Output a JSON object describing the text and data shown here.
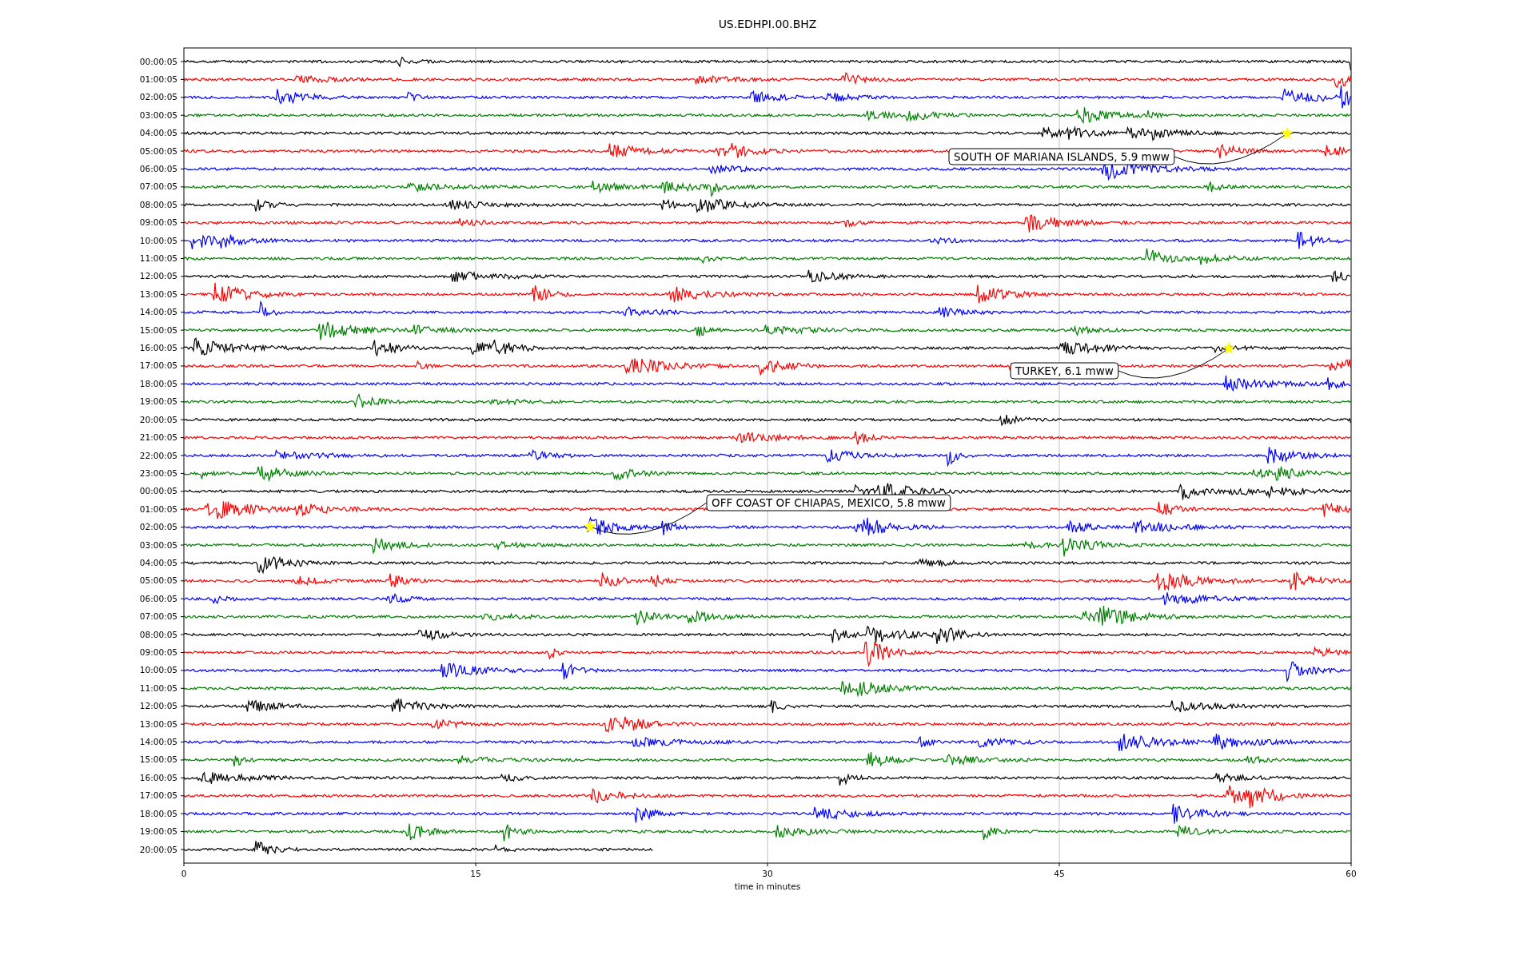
{
  "title": "US.EDHPI.00.BHZ",
  "rows": [
    {
      "label": "00:00:05",
      "color": "#000000"
    },
    {
      "label": "01:00:05",
      "color": "#ff0000"
    },
    {
      "label": "02:00:05",
      "color": "#0000ff"
    },
    {
      "label": "03:00:05",
      "color": "#008000"
    },
    {
      "label": "04:00:05",
      "color": "#000000"
    },
    {
      "label": "05:00:05",
      "color": "#ff0000"
    },
    {
      "label": "06:00:05",
      "color": "#0000ff"
    },
    {
      "label": "07:00:05",
      "color": "#008000"
    },
    {
      "label": "08:00:05",
      "color": "#000000"
    },
    {
      "label": "09:00:05",
      "color": "#ff0000"
    },
    {
      "label": "10:00:05",
      "color": "#0000ff"
    },
    {
      "label": "11:00:05",
      "color": "#008000"
    },
    {
      "label": "12:00:05",
      "color": "#000000"
    },
    {
      "label": "13:00:05",
      "color": "#ff0000"
    },
    {
      "label": "14:00:05",
      "color": "#0000ff"
    },
    {
      "label": "15:00:05",
      "color": "#008000"
    },
    {
      "label": "16:00:05",
      "color": "#000000"
    },
    {
      "label": "17:00:05",
      "color": "#ff0000"
    },
    {
      "label": "18:00:05",
      "color": "#0000ff"
    },
    {
      "label": "19:00:05",
      "color": "#008000"
    },
    {
      "label": "20:00:05",
      "color": "#000000"
    },
    {
      "label": "21:00:05",
      "color": "#ff0000"
    },
    {
      "label": "22:00:05",
      "color": "#0000ff"
    },
    {
      "label": "23:00:05",
      "color": "#008000"
    },
    {
      "label": "00:00:05",
      "color": "#000000"
    },
    {
      "label": "01:00:05",
      "color": "#ff0000"
    },
    {
      "label": "02:00:05",
      "color": "#0000ff"
    },
    {
      "label": "03:00:05",
      "color": "#008000"
    },
    {
      "label": "04:00:05",
      "color": "#000000"
    },
    {
      "label": "05:00:05",
      "color": "#ff0000"
    },
    {
      "label": "06:00:05",
      "color": "#0000ff"
    },
    {
      "label": "07:00:05",
      "color": "#008000"
    },
    {
      "label": "08:00:05",
      "color": "#000000"
    },
    {
      "label": "09:00:05",
      "color": "#ff0000"
    },
    {
      "label": "10:00:05",
      "color": "#0000ff"
    },
    {
      "label": "11:00:05",
      "color": "#008000"
    },
    {
      "label": "12:00:05",
      "color": "#000000"
    },
    {
      "label": "13:00:05",
      "color": "#ff0000"
    },
    {
      "label": "14:00:05",
      "color": "#0000ff"
    },
    {
      "label": "15:00:05",
      "color": "#008000"
    },
    {
      "label": "16:00:05",
      "color": "#000000"
    },
    {
      "label": "17:00:05",
      "color": "#ff0000"
    },
    {
      "label": "18:00:05",
      "color": "#0000ff"
    },
    {
      "label": "19:00:05",
      "color": "#008000"
    },
    {
      "label": "20:00:05",
      "color": "#000000"
    }
  ],
  "xticks": [
    "0",
    "15",
    "30",
    "45",
    "60"
  ],
  "xlabel": "time in minutes",
  "annotations": [
    {
      "text": "SOUTH OF MARIANA ISLANDS, 5.9 mww"
    },
    {
      "text": "TURKEY, 6.1 mww"
    },
    {
      "text": "OFF COAST OF CHIAPAS, MEXICO, 5.8 mww"
    }
  ]
}
